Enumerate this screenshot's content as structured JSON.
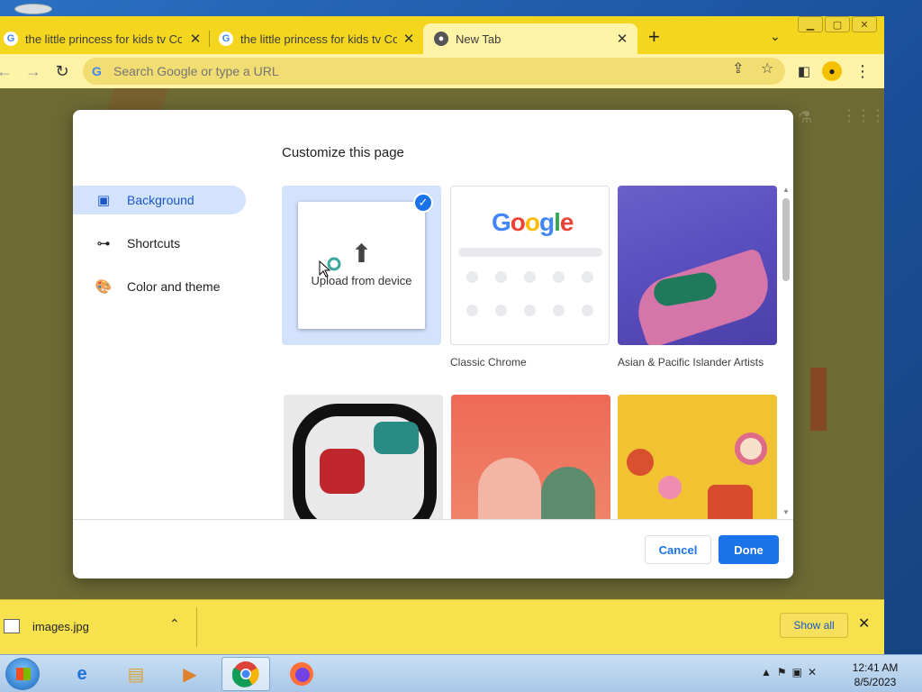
{
  "browser": {
    "tabs": [
      {
        "title": "the little princess for kids tv Com",
        "favicon": "google-g-icon",
        "active": false
      },
      {
        "title": "the little princess for kids tv Com",
        "favicon": "google-g-icon",
        "active": false
      },
      {
        "title": "New Tab",
        "favicon": "chrome-icon",
        "active": true
      }
    ],
    "new_tab_symbol": "+",
    "omnibox_placeholder": "Search Google or type a URL",
    "accent_color": "#f4d61f"
  },
  "modal": {
    "title": "Customize this page",
    "sidebar": [
      {
        "label": "Background",
        "icon": "image-icon",
        "active": true
      },
      {
        "label": "Shortcuts",
        "icon": "link-icon",
        "active": false
      },
      {
        "label": "Color and theme",
        "icon": "palette-icon",
        "active": false
      }
    ],
    "tiles": [
      {
        "label": "",
        "caption": "Upload from device",
        "selected": true
      },
      {
        "label": "Classic Chrome",
        "logo": "Google"
      },
      {
        "label": "Asian & Pacific Islander Artists"
      },
      {
        "label": ""
      },
      {
        "label": ""
      },
      {
        "label": ""
      }
    ],
    "cancel_label": "Cancel",
    "done_label": "Done"
  },
  "downloads": {
    "file_name": "images.jpg",
    "show_all_label": "Show all"
  },
  "taskbar": {
    "time": "12:41 AM",
    "date": "8/5/2023"
  }
}
